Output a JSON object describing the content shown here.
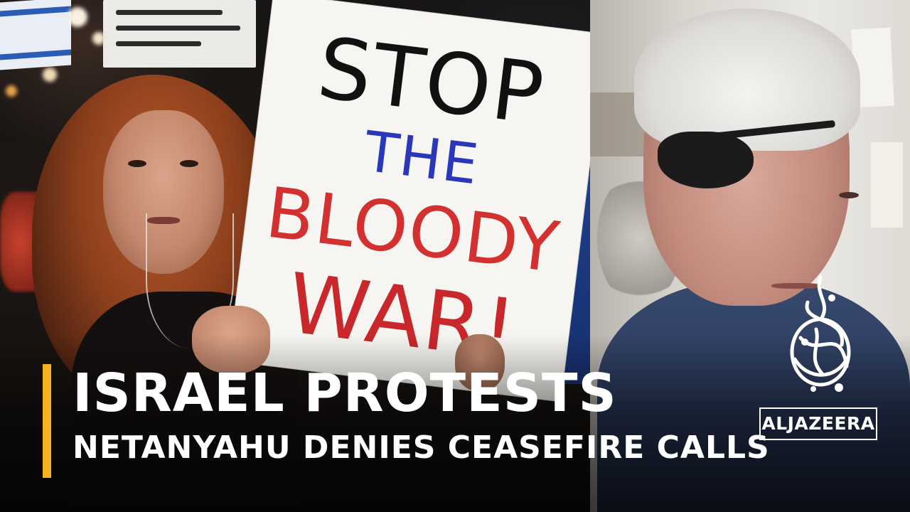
{
  "sign": {
    "line1": "STOP",
    "line2": "THE",
    "line3": "BLOODY",
    "line4": "WAR!"
  },
  "lower_third": {
    "headline": "ISRAEL PROTESTS",
    "subheadline": "NETANYAHU DENIES CEASEFIRE CALLS",
    "accent_color": "#f5b11e"
  },
  "logo": {
    "name": "ALJAZEERA",
    "icon": "aljazeera-calligraphy-icon"
  },
  "background_sign_icon": "israeli-flag-icon"
}
